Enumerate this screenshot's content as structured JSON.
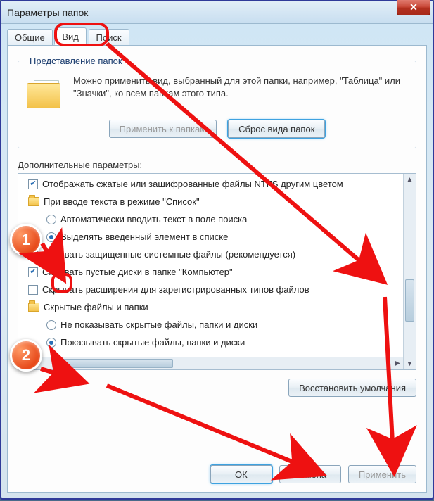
{
  "window": {
    "title": "Параметры папок",
    "close_glyph": "✕"
  },
  "tabs": [
    {
      "label": "Общие",
      "active": false
    },
    {
      "label": "Вид",
      "active": true
    },
    {
      "label": "Поиск",
      "active": false
    }
  ],
  "folder_view": {
    "legend": "Представление папок",
    "text": "Можно применить вид, выбранный для этой папки, например, \"Таблица\" или \"Значки\", ко всем папкам этого типа.",
    "apply_btn": "Применить к папкам",
    "apply_btn_enabled": false,
    "reset_btn": "Сброс вида папок"
  },
  "advanced": {
    "label": "Дополнительные параметры:",
    "items": [
      {
        "kind": "check",
        "checked": true,
        "indent": 0,
        "text": "Отображать сжатые или зашифрованные файлы NTFS другим цветом"
      },
      {
        "kind": "group",
        "indent": 0,
        "text": "При вводе текста в режиме \"Список\""
      },
      {
        "kind": "radio",
        "checked": false,
        "indent": 1,
        "text": "Автоматически вводить текст в поле поиска"
      },
      {
        "kind": "radio",
        "checked": true,
        "indent": 1,
        "text": "Выделять введенный элемент в списке"
      },
      {
        "kind": "check",
        "checked": false,
        "indent": 0,
        "text": "Скрывать защищенные системные файлы (рекомендуется)"
      },
      {
        "kind": "check",
        "checked": true,
        "indent": 0,
        "text": "Скрывать пустые диски в папке \"Компьютер\""
      },
      {
        "kind": "check",
        "checked": false,
        "indent": 0,
        "text": "Скрывать расширения для зарегистрированных типов файлов"
      },
      {
        "kind": "group",
        "indent": 0,
        "text": "Скрытые файлы и папки"
      },
      {
        "kind": "radio",
        "checked": false,
        "indent": 1,
        "text": "Не показывать скрытые файлы, папки и диски"
      },
      {
        "kind": "radio",
        "checked": true,
        "indent": 1,
        "text": "Показывать скрытые файлы, папки и диски"
      }
    ],
    "restore_btn": "Восстановить умолчания"
  },
  "buttons": {
    "ok": "ОК",
    "cancel": "Отмена",
    "apply": "Применить",
    "apply_enabled": false
  },
  "annotations": {
    "badge1": "1",
    "badge2": "2"
  }
}
